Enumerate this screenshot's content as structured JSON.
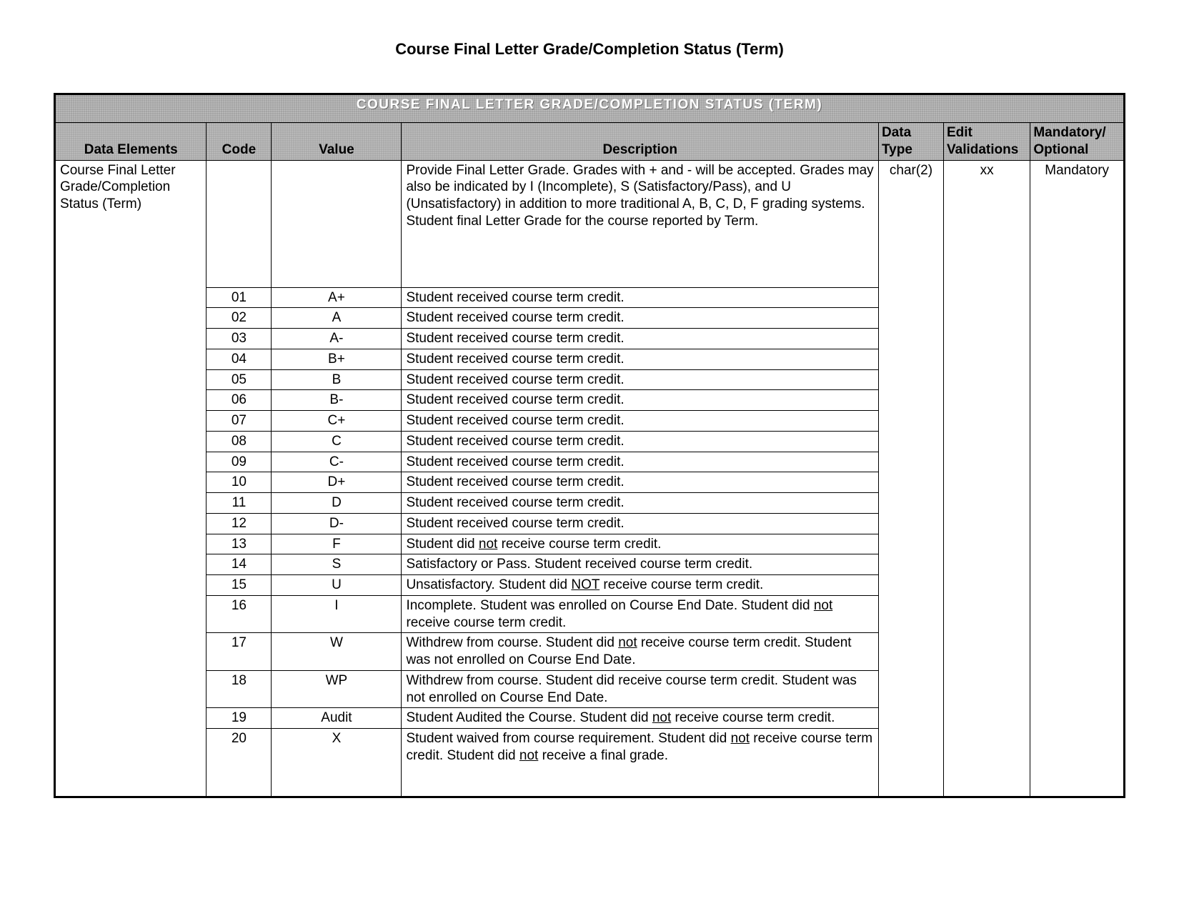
{
  "heading": "Course Final Letter Grade/Completion Status (Term)",
  "banner": "COURSE FINAL LETTER GRADE/COMPLETION STATUS (TERM)",
  "columns": {
    "elem": "Data Elements",
    "code": "Code",
    "value": "Value",
    "desc": "Description",
    "dtype": "Data Type",
    "edit": "Edit Validations",
    "mand": "Mandatory/ Optional"
  },
  "elem_name": "Course Final Letter Grade/Completion Status (Term)",
  "first_desc": "Provide Final Letter Grade.  Grades with + and - will be accepted.  Grades may also be indicated by I (Incomplete), S (Satisfactory/Pass), and U (Unsatisfactory) in addition to more traditional A, B, C, D, F grading systems.  Student final Letter Grade for the course reported by Term.",
  "dtype": "char(2)",
  "edit": "xx",
  "mand": "Mandatory",
  "rows": [
    {
      "code": "01",
      "value": "A+",
      "desc": "Student received course term credit."
    },
    {
      "code": "02",
      "value": "A",
      "desc": "Student received course term credit."
    },
    {
      "code": "03",
      "value": "A-",
      "desc": "Student received course term credit."
    },
    {
      "code": "04",
      "value": "B+",
      "desc": "Student received course term credit."
    },
    {
      "code": "05",
      "value": "B",
      "desc": "Student received course term credit."
    },
    {
      "code": "06",
      "value": "B-",
      "desc": "Student received course term credit."
    },
    {
      "code": "07",
      "value": "C+",
      "desc": "Student received course term credit."
    },
    {
      "code": "08",
      "value": "C",
      "desc": "Student received course term credit."
    },
    {
      "code": "09",
      "value": "C-",
      "desc": "Student received course term credit."
    },
    {
      "code": "10",
      "value": "D+",
      "desc": "Student received course term credit."
    },
    {
      "code": "11",
      "value": "D",
      "desc": "Student received course term credit."
    },
    {
      "code": "12",
      "value": "D-",
      "desc": "Student received course term credit."
    },
    {
      "code": "13",
      "value": "F",
      "desc_html": "Student did <span class=\"u\">not</span> receive course term credit."
    },
    {
      "code": "14",
      "value": "S",
      "desc": "Satisfactory or Pass. Student received course term credit."
    },
    {
      "code": "15",
      "value": "U",
      "desc_html": "Unsatisfactory.   Student did <span class=\"u\">NOT</span> receive course term credit."
    },
    {
      "code": "16",
      "value": "I",
      "desc_html": "Incomplete. Student was enrolled on Course End Date.  Student did <span class=\"u\">not</span> receive course term credit."
    },
    {
      "code": "17",
      "value": "W",
      "desc_html": "Withdrew from course. Student did <span class=\"u\">not</span> receive course term credit.  Student was not enrolled on Course End Date."
    },
    {
      "code": "18",
      "value": "WP",
      "desc": "Withdrew from course. Student did receive course term credit.  Student was not enrolled on Course End Date."
    },
    {
      "code": "19",
      "value": "Audit",
      "desc_html": "Student Audited the Course. Student did <span class=\"u\">not</span> receive course term credit."
    },
    {
      "code": "20",
      "value": "X",
      "desc_html": "Student waived from course requirement. Student did <span class=\"u\">not</span> receive course term credit. Student did <span class=\"u\">not</span> receive a final grade.",
      "tall": true
    }
  ]
}
